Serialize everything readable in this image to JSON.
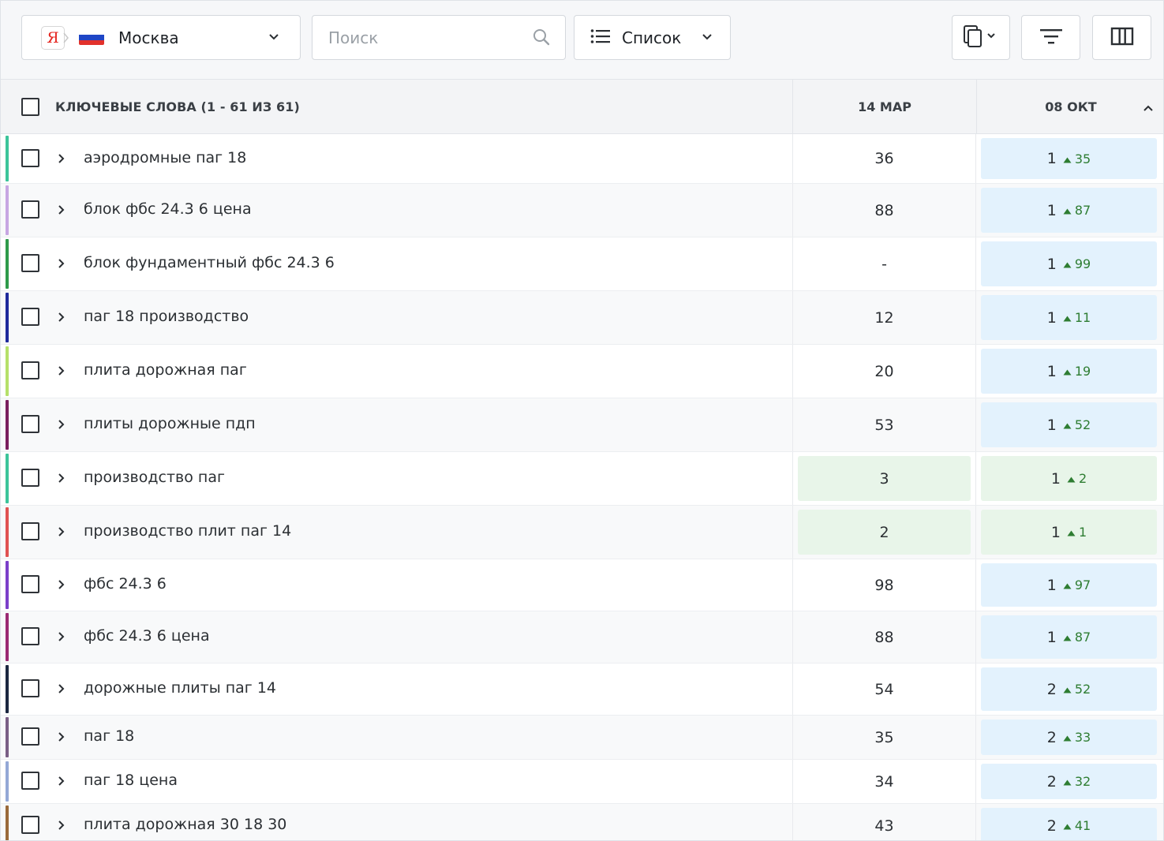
{
  "toolbar": {
    "search_engine_icon": "yandex-logo",
    "search_engine_letter": "Я",
    "region_flag": "russia-flag",
    "region_label": "Москва",
    "search_placeholder": "Поиск",
    "search_value": "",
    "view_mode_label": "Список",
    "icons": [
      "copy-icon",
      "filter-icon",
      "columns-icon"
    ]
  },
  "table": {
    "keywords_header": "КЛЮЧЕВЫЕ СЛОВА (1 - 61 ИЗ 61)",
    "date_columns": [
      "14 МАР",
      "08 ОКТ"
    ],
    "rows": [
      {
        "keyword": "аэродромные паг 18",
        "color": "#3cc49a",
        "prev": "36",
        "pos": "1",
        "delta": "35",
        "prev_bg": "",
        "pos_bg": "blue"
      },
      {
        "keyword": "блок фбс 24.3 6 цена",
        "color": "#c7a6e2",
        "prev": "88",
        "pos": "1",
        "delta": "87",
        "prev_bg": "",
        "pos_bg": "blue"
      },
      {
        "keyword": "блок фундаментный фбс 24.3 6",
        "color": "#2e9a4a",
        "prev": "-",
        "pos": "1",
        "delta": "99",
        "prev_bg": "",
        "pos_bg": "blue"
      },
      {
        "keyword": "паг 18 производство",
        "color": "#1f2a9c",
        "prev": "12",
        "pos": "1",
        "delta": "11",
        "prev_bg": "",
        "pos_bg": "blue"
      },
      {
        "keyword": "плита дорожная паг",
        "color": "#b5e06a",
        "prev": "20",
        "pos": "1",
        "delta": "19",
        "prev_bg": "",
        "pos_bg": "blue"
      },
      {
        "keyword": "плиты дорожные пдп",
        "color": "#7a1f5e",
        "prev": "53",
        "pos": "1",
        "delta": "52",
        "prev_bg": "",
        "pos_bg": "blue"
      },
      {
        "keyword": "производство паг",
        "color": "#3cc49a",
        "prev": "3",
        "pos": "1",
        "delta": "2",
        "prev_bg": "green",
        "pos_bg": "green"
      },
      {
        "keyword": "производство плит паг 14",
        "color": "#e05252",
        "prev": "2",
        "pos": "1",
        "delta": "1",
        "prev_bg": "green",
        "pos_bg": "green"
      },
      {
        "keyword": "фбс 24.3 6",
        "color": "#7b3fc9",
        "prev": "98",
        "pos": "1",
        "delta": "97",
        "prev_bg": "",
        "pos_bg": "blue"
      },
      {
        "keyword": "фбс 24.3 6 цена",
        "color": "#9b2a73",
        "prev": "88",
        "pos": "1",
        "delta": "87",
        "prev_bg": "",
        "pos_bg": "blue"
      },
      {
        "keyword": "дорожные плиты паг 14",
        "color": "#1b2740",
        "prev": "54",
        "pos": "2",
        "delta": "52",
        "prev_bg": "",
        "pos_bg": "blue"
      },
      {
        "keyword": "паг 18",
        "color": "#7a5f86",
        "prev": "35",
        "pos": "2",
        "delta": "33",
        "prev_bg": "",
        "pos_bg": "blue"
      },
      {
        "keyword": "паг 18 цена",
        "color": "#93a8d6",
        "prev": "34",
        "pos": "2",
        "delta": "32",
        "prev_bg": "",
        "pos_bg": "blue"
      },
      {
        "keyword": "плита дорожная 30 18 30",
        "color": "#9a6a3a",
        "prev": "43",
        "pos": "2",
        "delta": "41",
        "prev_bg": "",
        "pos_bg": "blue"
      }
    ]
  }
}
